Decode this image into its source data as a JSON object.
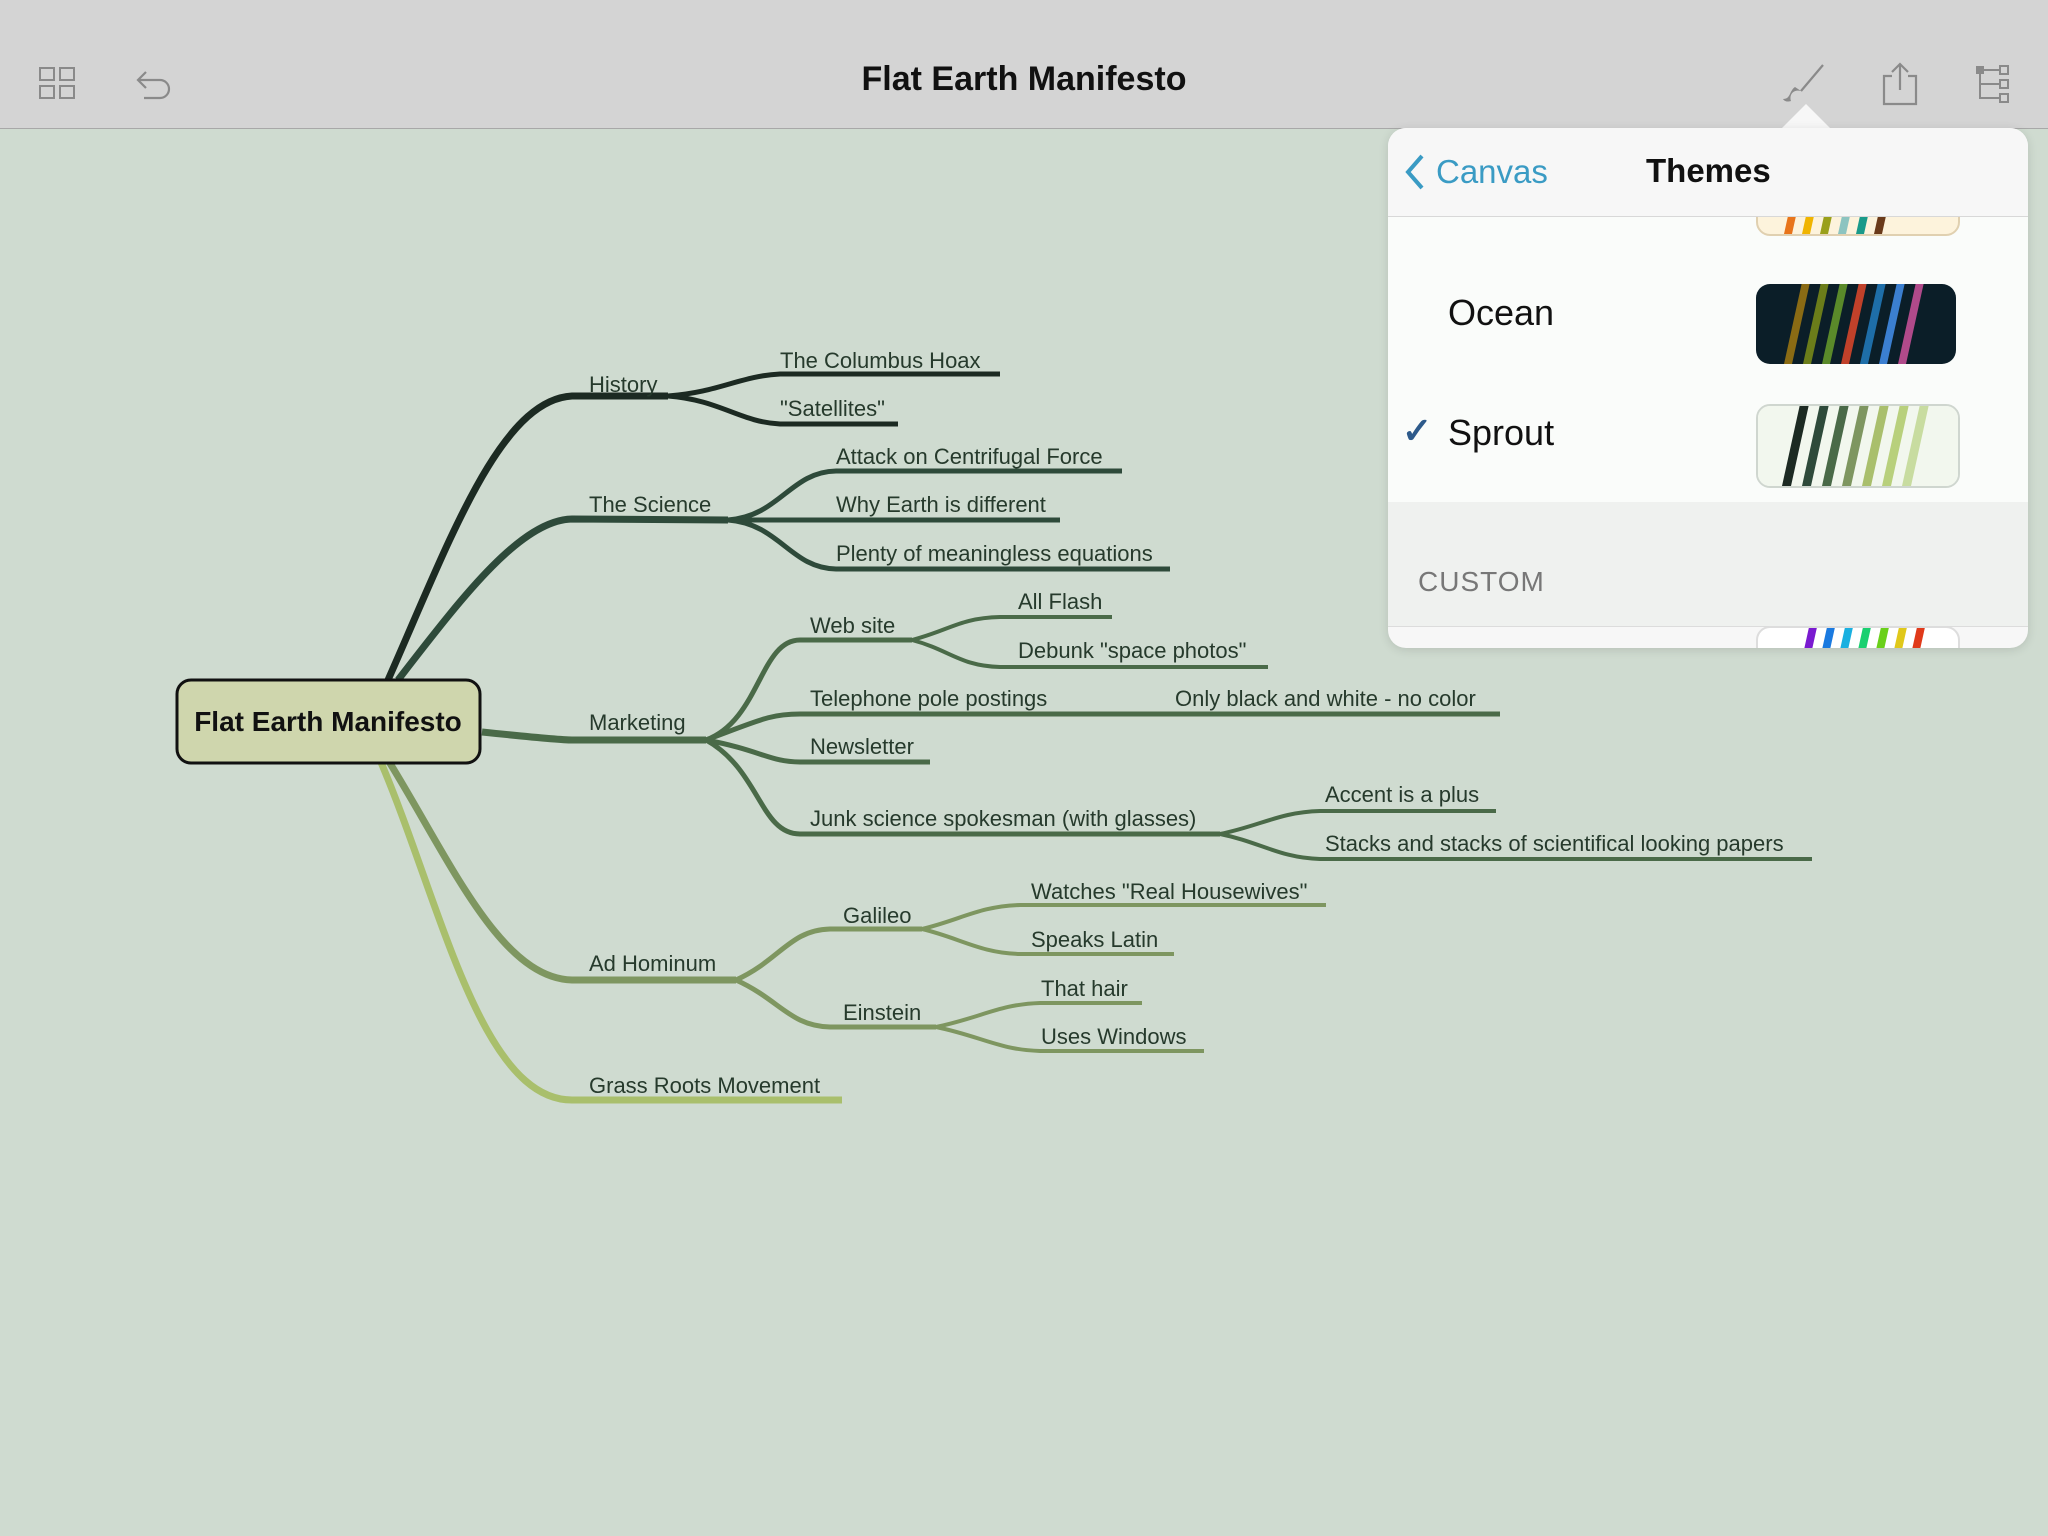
{
  "toolbar": {
    "title": "Flat Earth Manifesto",
    "icons": [
      "grid-icon",
      "undo-icon",
      "brush-icon",
      "share-icon",
      "outline-icon"
    ]
  },
  "mindmap": {
    "root": "Flat Earth Manifesto",
    "nodes": {
      "history": "History",
      "columbus": "The Columbus Hoax",
      "satellites": "\"Satellites\"",
      "science": "The Science",
      "centrifugal": "Attack on Centrifugal Force",
      "why_earth": "Why Earth is different",
      "equations": "Plenty of meaningless equations",
      "marketing": "Marketing",
      "website": "Web site",
      "all_flash": "All Flash",
      "debunk": "Debunk \"space photos\"",
      "telephone": "Telephone pole postings",
      "bw": "Only black and white - no color",
      "newsletter": "Newsletter",
      "junk": "Junk science spokesman (with glasses)",
      "accent": "Accent is a plus",
      "stacks": "Stacks and stacks of scientifical looking papers",
      "ad_hominum": "Ad Hominum",
      "galileo": "Galileo",
      "housewives": "Watches \"Real Housewives\"",
      "latin": "Speaks Latin",
      "einstein": "Einstein",
      "hair": "That hair",
      "windows": "Uses Windows",
      "grass": "Grass Roots Movement"
    },
    "colors": {
      "history": "#1c2a22",
      "science": "#2e4a3a",
      "marketing": "#4a6a48",
      "ad_hominum": "#7e9660",
      "grass": "#a9bf6c",
      "root_fill": "#cfd6ad"
    }
  },
  "popover": {
    "back_label": "Canvas",
    "title": "Themes",
    "themes": [
      {
        "name": "Ocean",
        "selected": false,
        "background": "#0b1e28",
        "stripes": [
          "#8a6b14",
          "#6b7d1a",
          "#5a8a2a",
          "#c0412a",
          "#1e6ea8",
          "#3b7fd0",
          "#b04a8a"
        ]
      },
      {
        "name": "Sprout",
        "selected": true,
        "background": "#f2f7ee",
        "stripes": [
          "#1c2a22",
          "#2e4a3a",
          "#4a6a48",
          "#7e9660",
          "#a9bf6c",
          "#b8d07c",
          "#c8dca0"
        ]
      }
    ],
    "check_mark": "✓",
    "custom_section_label": "CUSTOM",
    "top_partial_stripes": [
      "#e8741a",
      "#f0b400",
      "#9aa01a",
      "#8cc4c0",
      "#1a9a8a",
      "#6a3a1a"
    ],
    "custom_partial_stripes": [
      "#7a1ad0",
      "#1a7ae0",
      "#1ab0e0",
      "#1ad070",
      "#6ad01a",
      "#e0c81a",
      "#e03a1a"
    ]
  }
}
